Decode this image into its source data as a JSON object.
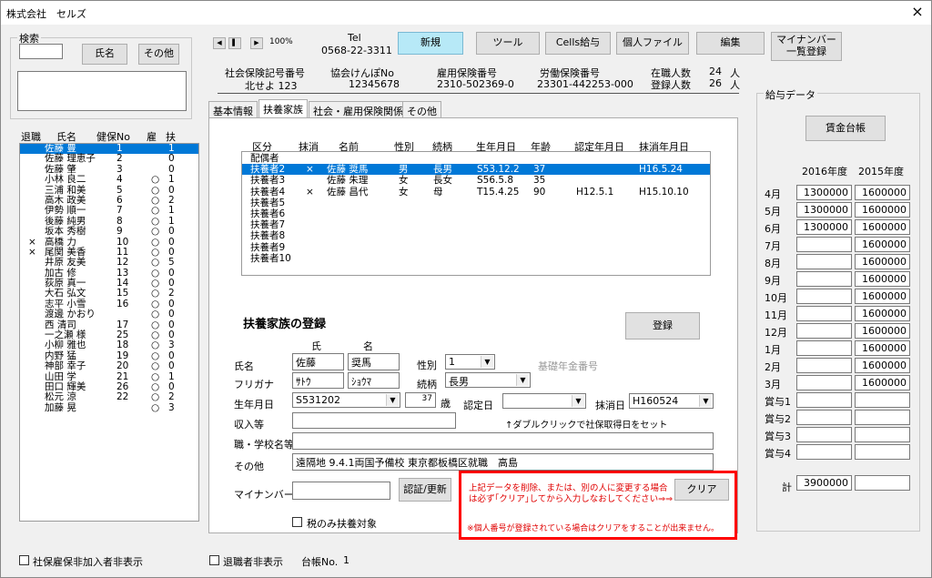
{
  "window": {
    "title": "株式会社　セルズ",
    "close": "×"
  },
  "search": {
    "label": "検索",
    "name_btn": "氏名",
    "other_btn": "その他"
  },
  "nav": {
    "first": "◀",
    "prev": "▌",
    "next": "▶",
    "zoom": "100%"
  },
  "tel": {
    "label": "Tel",
    "value": "0568-22-3311"
  },
  "toolbar": {
    "new": "新規",
    "tools": "ツール",
    "cells_salary": "Cells給与",
    "personal_file": "個人ファイル",
    "edit": "編集",
    "mynumber_list_1": "マイナンバー",
    "mynumber_list_2": "一覧登録"
  },
  "company": {
    "social_ins_label": "社会保険記号番号",
    "social_ins_value": "北せよ 123",
    "kenpo_label": "協会けんぽNo",
    "kenpo_value": "12345678",
    "emp_ins_label": "雇用保険番号",
    "emp_ins_value": "2310-502369-0",
    "labor_ins_label": "労働保険番号",
    "labor_ins_value": "23301-442253-000",
    "enrolled_label": "在職人数",
    "enrolled_value": "24",
    "enrolled_unit": "人",
    "registered_label": "登録人数",
    "registered_value": "26",
    "registered_unit": "人"
  },
  "employee_list": {
    "headers": [
      "退職",
      "氏名",
      "健保No",
      "雇",
      "扶"
    ],
    "rows": [
      {
        "ret": "",
        "name": "佐藤 豊",
        "no": "1",
        "emp": "",
        "dep": "1",
        "selected": true
      },
      {
        "ret": "",
        "name": "佐藤 理恵子",
        "no": "2",
        "emp": "",
        "dep": "0"
      },
      {
        "ret": "",
        "name": "佐藤 肇",
        "no": "3",
        "emp": "",
        "dep": "0"
      },
      {
        "ret": "",
        "name": "小林 良二",
        "no": "4",
        "emp": "○",
        "dep": "1"
      },
      {
        "ret": "",
        "name": "三浦 和美",
        "no": "5",
        "emp": "○",
        "dep": "0"
      },
      {
        "ret": "",
        "name": "高木 政美",
        "no": "6",
        "emp": "○",
        "dep": "2"
      },
      {
        "ret": "",
        "name": "伊勢 順一",
        "no": "7",
        "emp": "○",
        "dep": "1"
      },
      {
        "ret": "",
        "name": "後藤 純男",
        "no": "8",
        "emp": "○",
        "dep": "1"
      },
      {
        "ret": "",
        "name": "坂本 秀樹",
        "no": "9",
        "emp": "○",
        "dep": "0"
      },
      {
        "ret": "×",
        "name": "高橋 力",
        "no": "10",
        "emp": "○",
        "dep": "0"
      },
      {
        "ret": "×",
        "name": "尾関 美香",
        "no": "11",
        "emp": "○",
        "dep": "0"
      },
      {
        "ret": "",
        "name": "井原 友美",
        "no": "12",
        "emp": "○",
        "dep": "5"
      },
      {
        "ret": "",
        "name": "加古 修",
        "no": "13",
        "emp": "○",
        "dep": "0"
      },
      {
        "ret": "",
        "name": "荻原 真一",
        "no": "14",
        "emp": "○",
        "dep": "0"
      },
      {
        "ret": "",
        "name": "大石 弘文",
        "no": "15",
        "emp": "○",
        "dep": "2"
      },
      {
        "ret": "",
        "name": "志平 小雪",
        "no": "16",
        "emp": "○",
        "dep": "0"
      },
      {
        "ret": "",
        "name": "渡邊 かおり",
        "no": "",
        "emp": "○",
        "dep": "0"
      },
      {
        "ret": "",
        "name": "西 清司",
        "no": "17",
        "emp": "○",
        "dep": "0"
      },
      {
        "ret": "",
        "name": "一之瀬 様",
        "no": "25",
        "emp": "○",
        "dep": "0"
      },
      {
        "ret": "",
        "name": "小柳 雅也",
        "no": "18",
        "emp": "○",
        "dep": "3"
      },
      {
        "ret": "",
        "name": "内野 猛",
        "no": "19",
        "emp": "○",
        "dep": "0"
      },
      {
        "ret": "",
        "name": "神部 幸子",
        "no": "20",
        "emp": "○",
        "dep": "0"
      },
      {
        "ret": "",
        "name": "山田 学",
        "no": "21",
        "emp": "○",
        "dep": "1"
      },
      {
        "ret": "",
        "name": "田口 輝美",
        "no": "26",
        "emp": "○",
        "dep": "0"
      },
      {
        "ret": "",
        "name": "松元 涼",
        "no": "22",
        "emp": "○",
        "dep": "2"
      },
      {
        "ret": "",
        "name": "加藤 晃",
        "no": "",
        "emp": "○",
        "dep": "3"
      }
    ]
  },
  "tabs": [
    "基本情報",
    "扶養家族",
    "社会・雇用保険関係",
    "その他"
  ],
  "dependents": {
    "headers": [
      "区分",
      "抹消",
      "名前",
      "性別",
      "続柄",
      "生年月日",
      "年齢",
      "認定年月日",
      "抹消年月日"
    ],
    "rows": [
      {
        "kubun": "配偶者",
        "del": "",
        "name": "",
        "sex": "",
        "rel": "",
        "birth": "",
        "age": "",
        "cert": "",
        "delday": ""
      },
      {
        "kubun": "扶養者2",
        "del": "×",
        "name": "佐藤 奨馬",
        "sex": "男",
        "rel": "長男",
        "birth": "S53.12.2",
        "age": "37",
        "cert": "",
        "delday": "H16.5.24",
        "selected": true
      },
      {
        "kubun": "扶養者3",
        "del": "",
        "name": "佐藤 朱理",
        "sex": "女",
        "rel": "長女",
        "birth": "S56.5.8",
        "age": "35",
        "cert": "",
        "delday": ""
      },
      {
        "kubun": "扶養者4",
        "del": "×",
        "name": "佐藤 昌代",
        "sex": "女",
        "rel": "母",
        "birth": "T15.4.25",
        "age": "90",
        "cert": "H12.5.1",
        "delday": "H15.10.10"
      },
      {
        "kubun": "扶養者5",
        "del": "",
        "name": "",
        "sex": "",
        "rel": "",
        "birth": "",
        "age": "",
        "cert": "",
        "delday": ""
      },
      {
        "kubun": "扶養者6",
        "del": "",
        "name": "",
        "sex": "",
        "rel": "",
        "birth": "",
        "age": "",
        "cert": "",
        "delday": ""
      },
      {
        "kubun": "扶養者7",
        "del": "",
        "name": "",
        "sex": "",
        "rel": "",
        "birth": "",
        "age": "",
        "cert": "",
        "delday": ""
      },
      {
        "kubun": "扶養者8",
        "del": "",
        "name": "",
        "sex": "",
        "rel": "",
        "birth": "",
        "age": "",
        "cert": "",
        "delday": ""
      },
      {
        "kubun": "扶養者9",
        "del": "",
        "name": "",
        "sex": "",
        "rel": "",
        "birth": "",
        "age": "",
        "cert": "",
        "delday": ""
      },
      {
        "kubun": "扶養者10",
        "del": "",
        "name": "",
        "sex": "",
        "rel": "",
        "birth": "",
        "age": "",
        "cert": "",
        "delday": ""
      }
    ]
  },
  "form": {
    "section_title": "扶養家族の登録",
    "register_btn": "登録",
    "sei_label": "氏",
    "mei_label": "名",
    "name_label": "氏名",
    "sei": "佐藤",
    "mei": "奨馬",
    "furigana_label": "フリガナ",
    "sei_kana": "ｻﾄｳ",
    "mei_kana": "ｼｮｳﾏ",
    "sex_label": "性別",
    "sex_value": "1",
    "basic_pension_label": "基礎年金番号",
    "relation_label": "続柄",
    "relation_value": "長男",
    "birth_label": "生年月日",
    "birth_value": "S531202",
    "age_value": "37",
    "age_unit": "歳",
    "cert_label": "認定日",
    "cert_value": "",
    "del_label": "抹消日",
    "del_value": "H160524",
    "income_label": "収入等",
    "income_value": "",
    "double_click_hint": "↑ダブルクリックで社保取得日をセット",
    "school_label": "職・学校名等",
    "school_value": "",
    "other_label": "その他",
    "other_value": "遠隔地 9.4.1両国予備校 東京都板橋区就職　高島",
    "mynumber_label": "マイナンバー",
    "mynumber_value": "",
    "auth_btn": "認証/更新",
    "tax_only_label": "税のみ扶養対象",
    "warning_1": "上記データを削除、または、別の人に変更する場合",
    "warning_2": "は必ず｢クリア｣してから入力しなおしてください⇒⇒",
    "warning_3": "※個人番号が登録されている場合はクリアをすることが出来ません。",
    "clear_btn": "クリア"
  },
  "salary": {
    "title": "給与データ",
    "ledger_btn": "賃金台帳",
    "year1": "2016年度",
    "year2": "2015年度",
    "months": [
      {
        "label": "4月",
        "v1": "1300000",
        "v2": "1600000"
      },
      {
        "label": "5月",
        "v1": "1300000",
        "v2": "1600000"
      },
      {
        "label": "6月",
        "v1": "1300000",
        "v2": "1600000"
      },
      {
        "label": "7月",
        "v1": "",
        "v2": "1600000"
      },
      {
        "label": "8月",
        "v1": "",
        "v2": "1600000"
      },
      {
        "label": "9月",
        "v1": "",
        "v2": "1600000"
      },
      {
        "label": "10月",
        "v1": "",
        "v2": "1600000"
      },
      {
        "label": "11月",
        "v1": "",
        "v2": "1600000"
      },
      {
        "label": "12月",
        "v1": "",
        "v2": "1600000"
      },
      {
        "label": "1月",
        "v1": "",
        "v2": "1600000"
      },
      {
        "label": "2月",
        "v1": "",
        "v2": "1600000"
      },
      {
        "label": "3月",
        "v1": "",
        "v2": "1600000"
      },
      {
        "label": "賞与1",
        "v1": "",
        "v2": ""
      },
      {
        "label": "賞与2",
        "v1": "",
        "v2": ""
      },
      {
        "label": "賞与3",
        "v1": "",
        "v2": ""
      },
      {
        "label": "賞与4",
        "v1": "",
        "v2": ""
      }
    ],
    "total_label": "計",
    "total_v1": "3900000",
    "total_v2": ""
  },
  "footer": {
    "hide_uninsured": "社保雇保非加入者非表示",
    "hide_retired": "退職者非表示",
    "ledger_no_label": "台帳No.",
    "ledger_no_value": "1"
  }
}
